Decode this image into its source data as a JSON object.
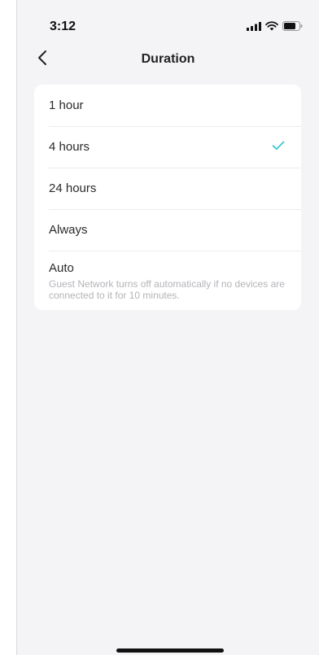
{
  "status_bar": {
    "time": "3:12",
    "icons": [
      "signal-icon",
      "wifi-icon",
      "battery-icon"
    ]
  },
  "nav": {
    "back_icon": "chevron-left-icon",
    "title": "Duration"
  },
  "options": [
    {
      "label": "1 hour",
      "selected": false
    },
    {
      "label": "4 hours",
      "selected": true
    },
    {
      "label": "24 hours",
      "selected": false
    },
    {
      "label": "Always",
      "selected": false
    },
    {
      "label": "Auto",
      "selected": false,
      "description": "Guest Network turns off automatically if no devices are connected to it for 10 minutes."
    }
  ],
  "colors": {
    "accent": "#3ec7cf",
    "background": "#f4f4f6",
    "card": "#ffffff"
  }
}
